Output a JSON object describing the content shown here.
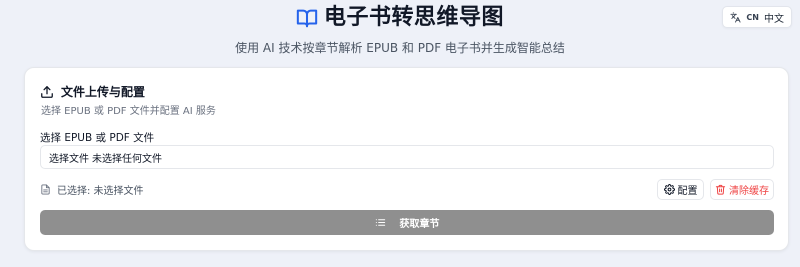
{
  "header": {
    "title": "电子书转思维导图",
    "subtitle": "使用 AI 技术按章节解析 EPUB 和 PDF 电子书并生成智能总结",
    "accent_color": "#2563eb"
  },
  "language_button": {
    "code": "CN",
    "label": "中文"
  },
  "upload_card": {
    "title": "文件上传与配置",
    "description": "选择 EPUB 或 PDF 文件并配置 AI 服务",
    "file_label": "选择 EPUB 或 PDF 文件",
    "file_button_text": "选择文件",
    "file_status_text": "未选择任何文件",
    "selected_text": "已选择: 未选择文件",
    "config_button": "配置",
    "clear_cache_button": "清除缓存",
    "fetch_chapters_button": "获取章节"
  },
  "icons": {
    "title_icon": "book-open-icon",
    "language_icon": "translate-icon",
    "upload_icon": "upload-icon",
    "file_icon": "file-text-icon",
    "config_icon": "gear-icon",
    "clear_icon": "trash-icon",
    "fetch_icon": "list-icon"
  },
  "colors": {
    "danger": "#ef4444",
    "disabled_button": "#8f8f8f",
    "background": "#eef1f8"
  }
}
